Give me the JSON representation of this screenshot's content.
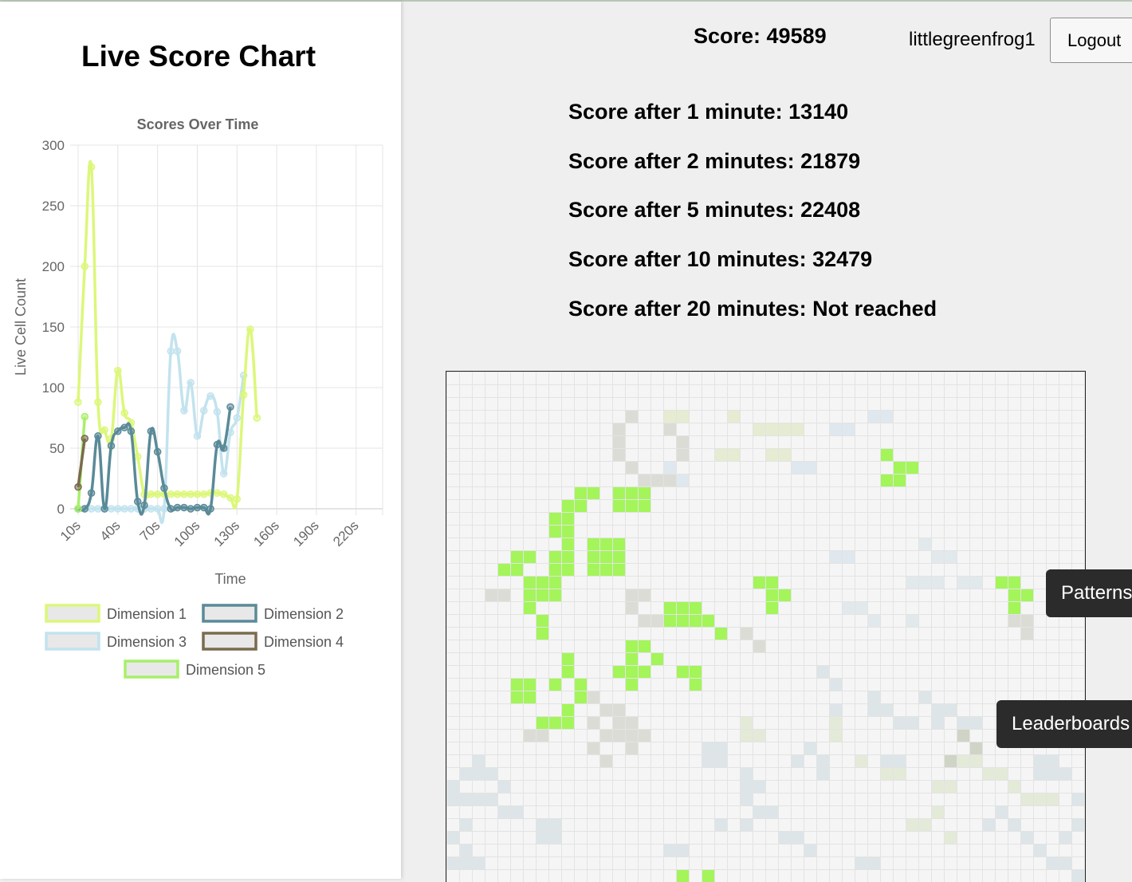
{
  "page_title": "Live Score Chart",
  "header": {
    "score_label": "Score: 49589",
    "username": "littlegreenfrog1",
    "logout_label": "Logout"
  },
  "milestones": [
    "Score after 1 minute: 13140",
    "Score after 2 minutes: 21879",
    "Score after 5 minutes: 22408",
    "Score after 10 minutes: 32479",
    "Score after 20 minutes: Not reached"
  ],
  "side_buttons": {
    "patterns": "Patterns",
    "leaderboards": "Leaderboards"
  },
  "colors": {
    "dimension1": "#dcf77a",
    "dimension2": "#5a8a98",
    "dimension3": "#c2e3ee",
    "dimension4": "#7a6b4e",
    "dimension5": "#a8ef6a",
    "active_cell": "#a3f55a",
    "side_button_bg": "#2b2b2b"
  },
  "chart_data": {
    "type": "line",
    "title": "Scores Over Time",
    "xlabel": "Time",
    "ylabel": "Live Cell Count",
    "ylim": [
      0,
      300
    ],
    "yticks": [
      0,
      50,
      100,
      150,
      200,
      250,
      300
    ],
    "x": [
      "10s",
      "15s",
      "20s",
      "25s",
      "30s",
      "35s",
      "40s",
      "45s",
      "50s",
      "55s",
      "60s",
      "65s",
      "70s",
      "75s",
      "80s",
      "85s",
      "90s",
      "95s",
      "100s",
      "105s",
      "110s",
      "115s",
      "120s",
      "125s",
      "130s",
      "135s",
      "140s",
      "145s",
      "150s",
      "155s",
      "160s",
      "165s",
      "170s",
      "175s",
      "180s",
      "185s",
      "190s",
      "195s",
      "200s",
      "205s",
      "210s",
      "215s",
      "220s",
      "225s",
      "230s",
      "235s",
      "240s"
    ],
    "xtick_labels": [
      "10s",
      "40s",
      "70s",
      "100s",
      "130s",
      "160s",
      "190s",
      "220s"
    ],
    "grid": true,
    "legend_position": "bottom",
    "series": [
      {
        "name": "Dimension 1",
        "values": [
          88,
          200,
          282,
          88,
          65,
          58,
          114,
          79,
          71,
          43,
          12,
          12,
          12,
          12,
          12,
          12,
          12,
          12,
          12,
          12,
          13,
          13,
          12,
          9,
          8,
          94,
          148,
          75
        ]
      },
      {
        "name": "Dimension 2",
        "values": [
          0,
          0,
          13,
          60,
          0,
          52,
          64,
          67,
          64,
          6,
          3,
          64,
          47,
          17,
          0,
          1,
          1,
          0,
          1,
          1,
          0,
          53,
          50,
          84
        ]
      },
      {
        "name": "Dimension 3",
        "values": [
          0,
          0,
          0,
          0,
          0,
          0,
          0,
          0,
          0,
          0,
          0,
          0,
          0,
          0,
          130,
          130,
          81,
          104,
          60,
          81,
          93,
          80,
          29,
          63,
          75,
          110
        ]
      },
      {
        "name": "Dimension 4",
        "values": [
          18,
          58
        ]
      },
      {
        "name": "Dimension 5",
        "values": [
          0,
          76
        ]
      }
    ]
  }
}
